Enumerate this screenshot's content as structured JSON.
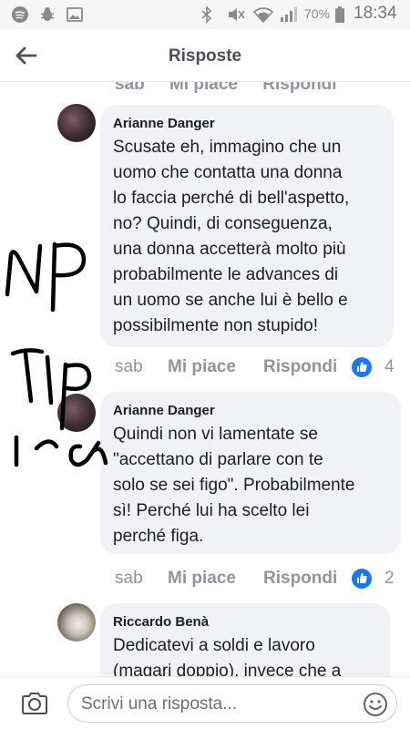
{
  "status_bar": {
    "battery_percent": "70%",
    "time": "18:34",
    "icons": [
      "spotify-icon",
      "bug-icon",
      "image-icon",
      "bluetooth-icon",
      "mute-icon",
      "wifi-icon",
      "signal-icon",
      "battery-icon"
    ]
  },
  "header": {
    "title": "Risposte"
  },
  "partial_actions": {
    "timestamp": "sab",
    "like_label": "Mi piace",
    "reply_label": "Rispondi"
  },
  "comments": [
    {
      "author": "Arianne Danger",
      "text": "Scusate eh, immagino che un\nuomo che contatta una donna\nlo faccia perché di bell'aspetto,\nno? Quindi, di conseguenza,\nuna donna accetterà molto più\nprobabilmente le advances di\nun uomo se anche lui è bello e\npossibilmente non stupido!",
      "timestamp": "sab",
      "like_label": "Mi piace",
      "reply_label": "Rispondi",
      "like_count": "4"
    },
    {
      "author": "Arianne Danger",
      "text": "Quindi non vi lamentate se\n\"accettano di parlare con te\nsolo se sei figo\". Probabilmente\nsì! Perché lui ha scelto lei\nperché figa.",
      "timestamp": "sab",
      "like_label": "Mi piace",
      "reply_label": "Rispondi",
      "like_count": "2"
    },
    {
      "author": "Riccardo Benà",
      "text": "Dedicatevi a soldi e lavoro\n(magari doppio), invece che a"
    }
  ],
  "composer": {
    "placeholder": "Scrivi una risposta..."
  },
  "colors": {
    "like_blue": "#1877f2",
    "bubble_bg": "#f1f2f6",
    "muted_text": "#90949c"
  }
}
